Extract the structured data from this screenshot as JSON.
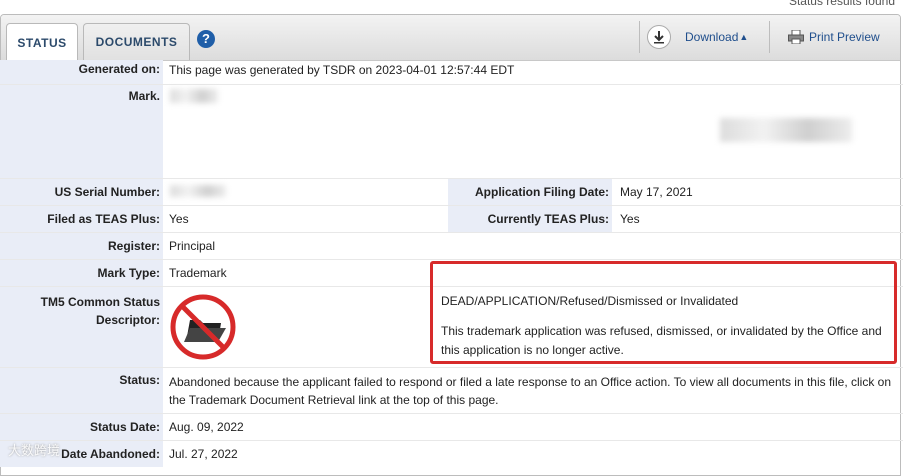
{
  "top_note": "Status results found",
  "toolbar": {
    "tab_status": "STATUS",
    "tab_documents": "DOCUMENTS",
    "help": "?",
    "download_label": "Download",
    "download_caret": "▲",
    "print_label": "Print Preview"
  },
  "fields": {
    "generated_label": "Generated on:",
    "generated_value": "This page was generated by TSDR on 2023-04-01 12:57:44 EDT",
    "mark_label": "Mark.",
    "serial_label": "US Serial Number:",
    "filing_label": "Application Filing Date:",
    "filing_value": "May 17, 2021",
    "teas_plus_label": "Filed as TEAS Plus:",
    "teas_plus_value": "Yes",
    "current_teas_label": "Currently TEAS Plus:",
    "current_teas_value": "Yes",
    "register_label": "Register:",
    "register_value": "Principal",
    "mark_type_label": "Mark Type:",
    "mark_type_value": "Trademark",
    "tm5_label_1": "TM5 Common Status",
    "tm5_label_2": "Descriptor:",
    "tm5_status": "DEAD/APPLICATION/Refused/Dismissed or Invalidated",
    "tm5_desc": "This trademark application was refused, dismissed, or invalidated by the Office and this application is no longer active.",
    "status_label": "Status:",
    "status_value": "Abandoned because the applicant failed to respond or filed a late response to an Office action. To view all documents in this file, click on the Trademark Document Retrieval link at the top of this page.",
    "status_date_label": "Status Date:",
    "status_date_value": "Aug. 09, 2022",
    "abandoned_label": "Date Abandoned:",
    "abandoned_value": "Jul. 27, 2022"
  },
  "watermark": "大数跨境",
  "colors": {
    "label_bg": "#e9edf7",
    "link": "#1f4e8c",
    "highlight": "#d72a2a",
    "no_symbol": "#d72a2a"
  },
  "icons": [
    "help-icon",
    "download-icon",
    "print-icon",
    "dead-folder-icon"
  ]
}
